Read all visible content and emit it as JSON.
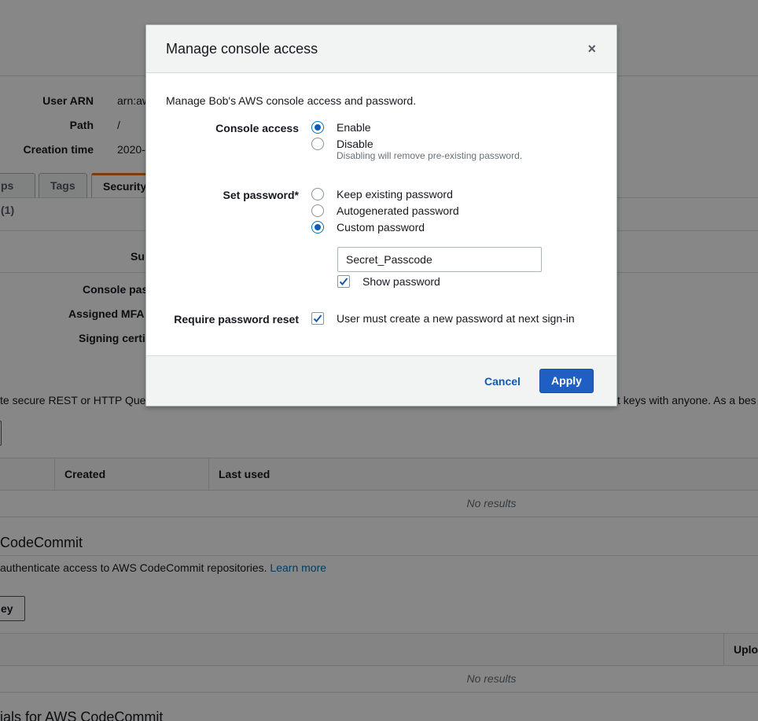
{
  "background": {
    "summary": {
      "user_arn_label": "User ARN",
      "user_arn_value": "arn:aw",
      "path_label": "Path",
      "path_value": "/",
      "creation_time_label": "Creation time",
      "creation_time_value": "2020-"
    },
    "tabs": [
      "ps (1)",
      "Tags",
      "Security"
    ],
    "credentials": {
      "summary_label": "Su",
      "console_password_label": "Console pas",
      "assigned_mfa_label": "Assigned MFA",
      "signing_cert_label": "Signing certi"
    },
    "access_keys_text_left": "te secure REST or HTTP Quer",
    "access_keys_text_right": "t keys with anyone. As a bes",
    "access_keys_table": {
      "columns": [
        "Created",
        "Last used"
      ],
      "no_results": "No results"
    },
    "codecommit": {
      "heading": " CodeCommit",
      "description": "authenticate access to AWS CodeCommit repositories.",
      "learn_more": "Learn more",
      "button_label": "ey",
      "table_column": "Uplo",
      "no_results": "No results",
      "next_heading": "ials for AWS CodeCommit"
    }
  },
  "modal": {
    "title": "Manage console access",
    "close_glyph": "×",
    "intro": "Manage Bob's AWS console access and password.",
    "console_access": {
      "label": "Console access",
      "options": [
        {
          "label": "Enable",
          "selected": true
        },
        {
          "label": "Disable",
          "selected": false
        }
      ],
      "disable_hint": "Disabling will remove pre-existing password."
    },
    "set_password": {
      "label": "Set password*",
      "options": [
        {
          "label": "Keep existing password",
          "selected": false
        },
        {
          "label": "Autogenerated password",
          "selected": false
        },
        {
          "label": "Custom password",
          "selected": true
        }
      ],
      "custom_value": "Secret_Passcode",
      "show_password_label": "Show password",
      "show_password_checked": true
    },
    "require_reset": {
      "label": "Require password reset",
      "checkbox_label": "User must create a new password at next sign-in",
      "checked": true
    },
    "cancel_label": "Cancel",
    "apply_label": "Apply"
  },
  "colors": {
    "accent": "#1f5fc4",
    "link": "#0f5bb5",
    "overlay": "rgba(0,0,0,0.47)"
  }
}
